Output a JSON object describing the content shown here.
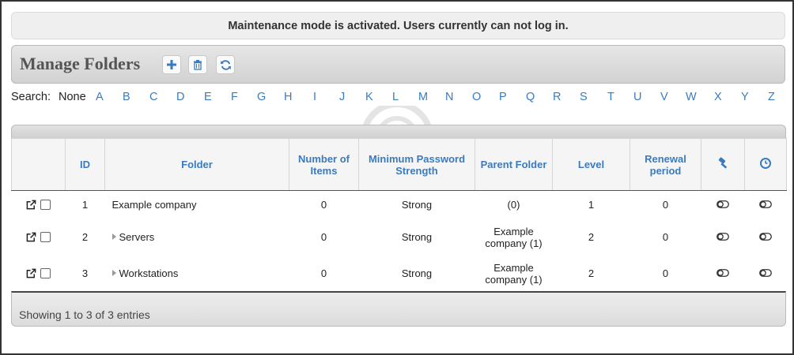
{
  "notice": "Maintenance mode is activated. Users currently can not log in.",
  "page_title": "Manage Folders",
  "toolbar": {
    "add_icon": "plus-icon",
    "delete_icon": "trash-icon",
    "refresh_icon": "refresh-icon"
  },
  "search": {
    "label": "Search:",
    "none": "None",
    "letters": [
      "A",
      "B",
      "C",
      "D",
      "E",
      "F",
      "G",
      "H",
      "I",
      "J",
      "K",
      "L",
      "M",
      "N",
      "O",
      "P",
      "Q",
      "R",
      "S",
      "T",
      "U",
      "V",
      "W",
      "X",
      "Y",
      "Z"
    ]
  },
  "table": {
    "headers": {
      "id": "ID",
      "folder": "Folder",
      "items": "Number of Items",
      "strength": "Minimum Password Strength",
      "parent": "Parent Folder",
      "level": "Level",
      "renewal": "Renewal period",
      "col_hammer_icon": "hammer-icon",
      "col_clock_icon": "clock-icon"
    },
    "rows": [
      {
        "id": "1",
        "folder": "Example company",
        "items": "0",
        "strength": "Strong",
        "parent": "(0)",
        "level": "1",
        "renewal": "0"
      },
      {
        "id": "2",
        "folder": "Servers",
        "items": "0",
        "strength": "Strong",
        "parent": "Example company (1)",
        "level": "2",
        "renewal": "0"
      },
      {
        "id": "3",
        "folder": "Workstations",
        "items": "0",
        "strength": "Strong",
        "parent": "Example company (1)",
        "level": "2",
        "renewal": "0"
      }
    ]
  },
  "footer": "Showing 1 to 3 of 3 entries",
  "colors": {
    "link": "#3a7bbf",
    "header_bg": "#d2d2d2",
    "notice_bg": "#efefef"
  }
}
